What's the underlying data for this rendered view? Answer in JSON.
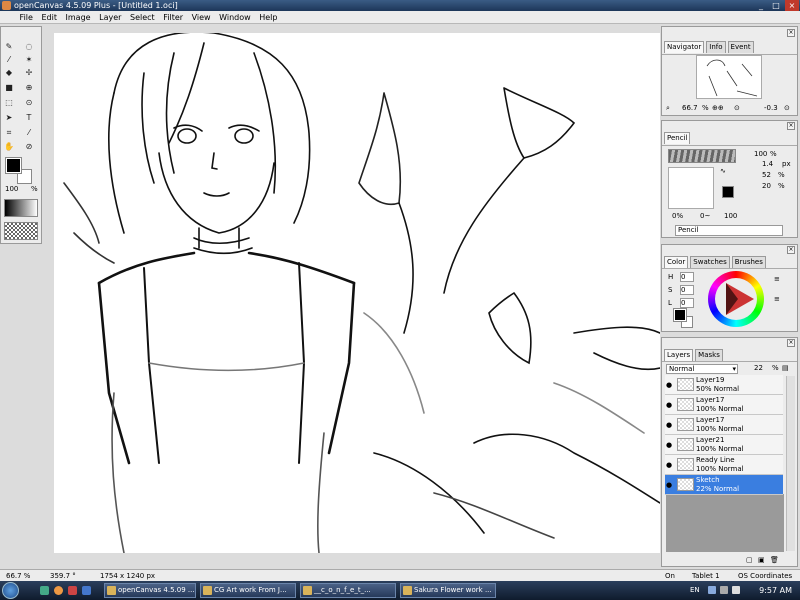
{
  "window": {
    "title": "openCanvas 4.5.09 Plus - [Untitled 1.oci]",
    "minimize": "_",
    "maximize": "□",
    "close": "×"
  },
  "menu": [
    "File",
    "Edit",
    "Image",
    "Layer",
    "Select",
    "Filter",
    "View",
    "Window",
    "Help"
  ],
  "toolbox": {
    "tools": [
      "pencil-icon",
      "lasso-icon",
      "brush-icon",
      "magic-wand-icon",
      "eraser-icon",
      "move-icon",
      "fill-icon",
      "dropper-icon",
      "rect-select-icon",
      "zoom-icon",
      "arrow-icon",
      "text-icon",
      "crop-icon",
      "eyedropper-icon",
      "hand-icon",
      "magnifier-icon"
    ],
    "size_value": "100",
    "size_unit": "%"
  },
  "navigator": {
    "tabs": [
      "Navigator",
      "Info",
      "Event"
    ],
    "zoom": "66.7",
    "zoom_unit": "%",
    "rotation": "-0.3"
  },
  "pencil": {
    "tab": "Pencil",
    "size_a": "100",
    "size_a_unit": "%",
    "size_b": "1.4",
    "size_b_unit": "px",
    "opacity": "52",
    "opacity_unit": "%",
    "density": "20",
    "density_unit": "%",
    "low": "0%",
    "mid": "0~",
    "high": "100",
    "tool_name": "Pencil"
  },
  "color": {
    "tabs": [
      "Color",
      "Swatches",
      "Brushes"
    ],
    "h_label": "H",
    "h": "0",
    "s_label": "S",
    "s": "0",
    "l_label": "L",
    "l": "0"
  },
  "layers": {
    "tabs": [
      "Layers",
      "Masks"
    ],
    "blend_mode": "Normal",
    "opacity": "22",
    "opacity_unit": "%",
    "items": [
      {
        "name": "Layer19",
        "mode": "50% Normal"
      },
      {
        "name": "Layer17",
        "mode": "100% Normal"
      },
      {
        "name": "Layer17",
        "mode": "100% Normal"
      },
      {
        "name": "Layer21",
        "mode": "100% Normal"
      },
      {
        "name": "Ready Line",
        "mode": "100% Normal"
      },
      {
        "name": "Sketch",
        "mode": "22% Normal"
      }
    ]
  },
  "status": {
    "zoom": "66.7 %",
    "angle": "359.7 °",
    "dims": "1754 x 1240 px",
    "on": "On",
    "tablet": "Tablet 1",
    "coords": "OS Coordinates"
  },
  "taskbar": {
    "items": [
      "openCanvas 4.5.09 ...",
      "CG Art work From J...",
      "__c_o_n_f_e_t_...",
      "Sakura Flower work ..."
    ],
    "lang": "EN",
    "clock": "9:57 AM"
  }
}
